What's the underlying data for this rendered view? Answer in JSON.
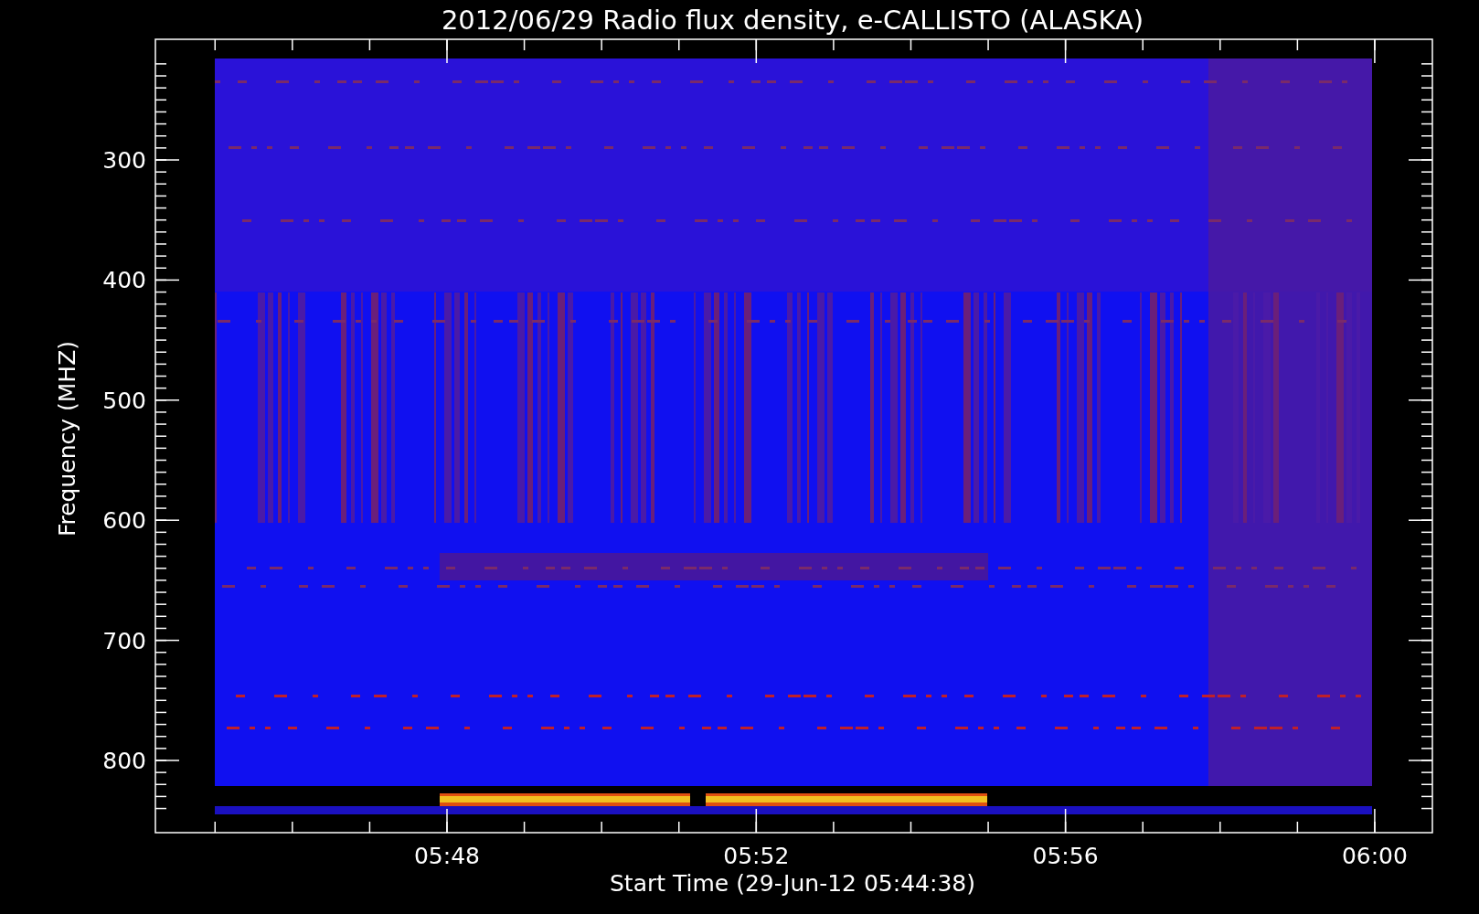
{
  "title": "2012/06/29  Radio flux density, e-CALLISTO (ALASKA)",
  "y_axis": {
    "label": "Frequency (MHZ)",
    "ticks": [
      "300",
      "400",
      "500",
      "600",
      "700",
      "800"
    ]
  },
  "x_axis": {
    "label": "Start Time (29-Jun-12 05:44:38)",
    "ticks": [
      "05:48",
      "05:52",
      "05:56",
      "06:00"
    ]
  }
}
